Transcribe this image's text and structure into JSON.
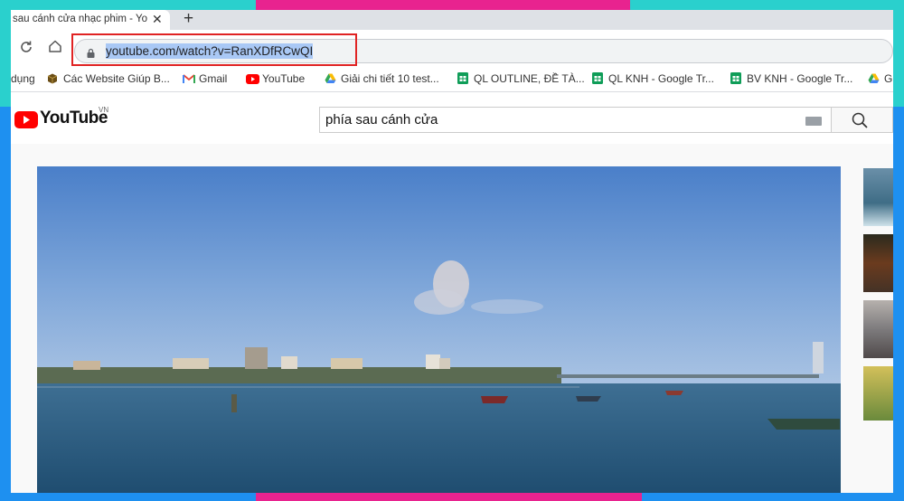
{
  "browser": {
    "tab_title": "sau cánh cửa nhạc phim - Yo",
    "tab_close_glyph": "✕",
    "new_tab_glyph": "+",
    "url": "youtube.com/watch?v=RanXDfRCwQI"
  },
  "bookmarks": [
    {
      "label": "dụng",
      "icon": "bookmark-fragment"
    },
    {
      "label": "Các Website Giúp B...",
      "icon": "cube-icon",
      "color": "#6b4e16"
    },
    {
      "label": "Gmail",
      "icon": "gmail-icon"
    },
    {
      "label": "YouTube",
      "icon": "youtube-icon"
    },
    {
      "label": "Giải chi tiết 10 test...",
      "icon": "drive-icon"
    },
    {
      "label": "QL OUTLINE, ĐỀ TÀ...",
      "icon": "sheets-icon"
    },
    {
      "label": "QL KNH - Google Tr...",
      "icon": "sheets-icon"
    },
    {
      "label": "BV KNH - Google Tr...",
      "icon": "sheets-icon"
    },
    {
      "label": "G",
      "icon": "drive-icon"
    }
  ],
  "youtube": {
    "logo_text": "YouTube",
    "country_code": "VN",
    "search_value": "phía sau cánh cửa"
  },
  "colors": {
    "frame_teal": "#2ad0cd",
    "frame_magenta": "#e8238f",
    "frame_blue": "#1e90f0",
    "url_highlight_border": "#e02323",
    "youtube_red": "#ff0000"
  }
}
